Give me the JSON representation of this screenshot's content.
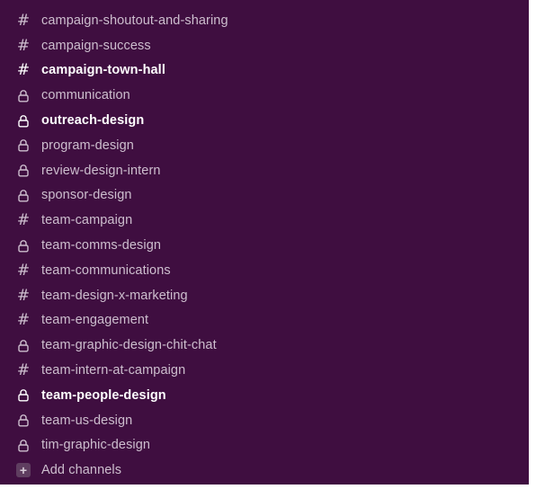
{
  "sidebar": {
    "channels": [
      {
        "name": "campaign-shoutout-and-sharing",
        "type": "hash",
        "icon": "hash-icon",
        "bold": false
      },
      {
        "name": "campaign-success",
        "type": "hash",
        "icon": "hash-icon",
        "bold": false
      },
      {
        "name": "campaign-town-hall",
        "type": "hash",
        "icon": "hash-icon",
        "bold": true
      },
      {
        "name": "communication",
        "type": "lock",
        "icon": "lock-icon",
        "bold": false
      },
      {
        "name": "outreach-design",
        "type": "lock",
        "icon": "lock-icon",
        "bold": true
      },
      {
        "name": "program-design",
        "type": "lock",
        "icon": "lock-icon",
        "bold": false
      },
      {
        "name": "review-design-intern",
        "type": "lock",
        "icon": "lock-icon",
        "bold": false
      },
      {
        "name": "sponsor-design",
        "type": "lock",
        "icon": "lock-icon",
        "bold": false
      },
      {
        "name": "team-campaign",
        "type": "hash",
        "icon": "hash-icon",
        "bold": false
      },
      {
        "name": "team-comms-design",
        "type": "lock",
        "icon": "lock-icon",
        "bold": false
      },
      {
        "name": "team-communications",
        "type": "hash",
        "icon": "hash-icon",
        "bold": false
      },
      {
        "name": "team-design-x-marketing",
        "type": "hash",
        "icon": "hash-icon",
        "bold": false
      },
      {
        "name": "team-engagement",
        "type": "hash",
        "icon": "hash-icon",
        "bold": false
      },
      {
        "name": "team-graphic-design-chit-chat",
        "type": "lock",
        "icon": "lock-icon",
        "bold": false
      },
      {
        "name": "team-intern-at-campaign",
        "type": "hash",
        "icon": "hash-icon",
        "bold": false
      },
      {
        "name": "team-people-design",
        "type": "lock",
        "icon": "lock-icon",
        "bold": true
      },
      {
        "name": "team-us-design",
        "type": "lock",
        "icon": "lock-icon",
        "bold": false
      },
      {
        "name": "tim-graphic-design",
        "type": "lock",
        "icon": "lock-icon",
        "bold": false
      }
    ],
    "add_channels": {
      "label": "Add channels",
      "icon": "plus-icon"
    }
  },
  "colors": {
    "sidebar_bg": "#3f0e40",
    "text_muted": "#cdbece",
    "text_unread": "#ffffff",
    "add_box_bg": "#5f3e60"
  }
}
